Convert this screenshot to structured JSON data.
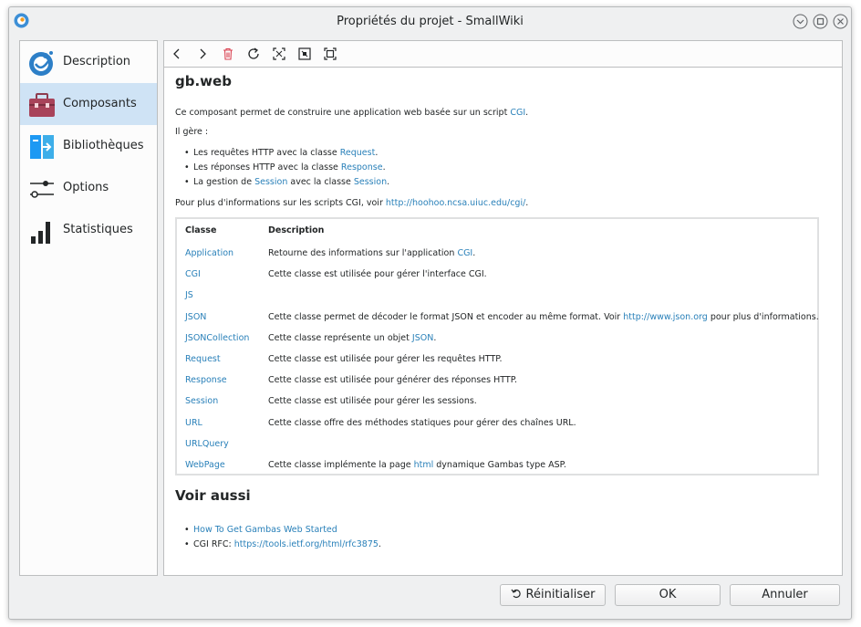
{
  "window": {
    "title": "Propriétés du projet - SmallWiki"
  },
  "sidebar": {
    "items": [
      {
        "label": "Description",
        "icon": "gambas-icon"
      },
      {
        "label": "Composants",
        "icon": "toolbox-icon",
        "selected": true
      },
      {
        "label": "Bibliothèques",
        "icon": "library-icon"
      },
      {
        "label": "Options",
        "icon": "sliders-icon"
      },
      {
        "label": "Statistiques",
        "icon": "bar-chart-icon"
      }
    ]
  },
  "toolbar": {
    "buttons": [
      "back-icon",
      "forward-icon",
      "delete-icon",
      "refresh-icon",
      "zoom-in-icon",
      "zoom-out-icon",
      "fit-icon"
    ]
  },
  "doc": {
    "title": "gb.web",
    "intro_prefix": "Ce composant permet de construire une application web basée sur un script",
    "intro_link": "CGI",
    "intro_suffix": ".",
    "manages": "Il gère :",
    "bullets": [
      {
        "prefix": "Les requêtes HTTP avec la classe",
        "link": "Request",
        "suffix": "."
      },
      {
        "prefix": "Les réponses HTTP avec la classe",
        "link": "Response",
        "suffix": "."
      },
      {
        "prefix": "La gestion de",
        "link": "Session",
        "middle": "avec la classe",
        "link2": "Session",
        "suffix": "."
      }
    ],
    "more_prefix": "Pour plus d'informations sur les scripts CGI, voir",
    "more_link": "http://hoohoo.ncsa.uiuc.edu/cgi/",
    "more_suffix": ".",
    "table": {
      "headers": [
        "Classe",
        "Description"
      ],
      "rows": [
        {
          "cls": "Application",
          "desc": "Retourne des informations sur l'application",
          "link": "CGI",
          "tail": "."
        },
        {
          "cls": "CGI",
          "desc": "Cette classe est utilisée pour gérer l'interface CGI.",
          "link": "",
          "tail": ""
        },
        {
          "cls": "JS",
          "desc": "",
          "link": "",
          "tail": ""
        },
        {
          "cls": "JSON",
          "desc": "Cette classe permet de décoder le format JSON et encoder au même format. Voir",
          "link": "http://www.json.org",
          "tail": "pour plus d'informations."
        },
        {
          "cls": "JSONCollection",
          "desc": "Cette classe représente un objet",
          "link": "JSON",
          "tail": "."
        },
        {
          "cls": "Request",
          "desc": "Cette classe est utilisée pour gérer les requêtes HTTP.",
          "link": "",
          "tail": ""
        },
        {
          "cls": "Response",
          "desc": "Cette classe est utilisée pour générer des réponses HTTP.",
          "link": "",
          "tail": ""
        },
        {
          "cls": "Session",
          "desc": "Cette classe est utilisée pour gérer les sessions.",
          "link": "",
          "tail": ""
        },
        {
          "cls": "URL",
          "desc": "Cette classe offre des méthodes statiques pour gérer des chaînes URL.",
          "link": "",
          "tail": ""
        },
        {
          "cls": "URLQuery",
          "desc": "",
          "link": "",
          "tail": ""
        },
        {
          "cls": "WebPage",
          "desc": "Cette classe implémente la page",
          "link": "html",
          "tail": "dynamique Gambas type ASP."
        }
      ]
    },
    "see_also_title": "Voir aussi",
    "see_also": [
      {
        "prefix": "",
        "link": "How To Get Gambas Web Started",
        "suffix": ""
      },
      {
        "prefix": "CGI RFC:",
        "link": "https://tools.ietf.org/html/rfc3875",
        "suffix": "."
      }
    ]
  },
  "buttons": {
    "reset": "Réinitialiser",
    "ok": "OK",
    "cancel": "Annuler"
  },
  "colors": {
    "link": "#2980b9",
    "selection": "#cfe3f5",
    "delete": "#da4453"
  }
}
